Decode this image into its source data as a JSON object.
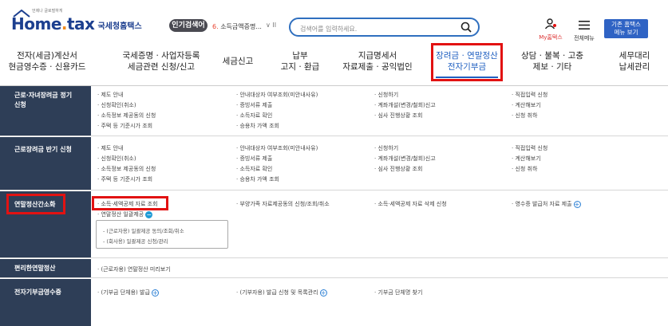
{
  "header": {
    "logo_home": "Home",
    "logo_tax": "tax",
    "logo_tag": "국세청홈택스",
    "logo_small": "언제나 글로벌하게",
    "hot_badge": "인기검색어",
    "hot_rank": "6.",
    "hot_term": "소득금액증명...",
    "hot_ctrl": "∨ II",
    "search_placeholder": "검색어를 입력하세요.",
    "my_label": "My홈택스",
    "allmenu_label": "전체메뉴",
    "basic_btn_line1": "기존 홈택스",
    "basic_btn_line2": "메뉴 보기"
  },
  "gnb": {
    "items": [
      {
        "l1": "전자(세금)계산서",
        "l2": "현금영수증 · 신용카드"
      },
      {
        "l1": "국세증명 · 사업자등록",
        "l2": "세금관련 신청/신고"
      },
      {
        "l1": "세금신고",
        "l2": ""
      },
      {
        "l1": "납부",
        "l2": "고지 · 환급"
      },
      {
        "l1": "지급명세서",
        "l2": "자료제출 · 공익법인"
      },
      {
        "l1": "장려금 · 연말정산",
        "l2": "전자기부금"
      },
      {
        "l1": "상담 · 불복 · 고충",
        "l2": "제보 · 기타"
      },
      {
        "l1": "세무대리",
        "l2": "납세관리"
      }
    ]
  },
  "rows": [
    {
      "label1": "근로·자녀장려금 정기",
      "label2": "신청",
      "col1": [
        "· 제도 안내",
        "· 신청확인(취소)",
        "· 소득정보 제공동의 신청",
        "· 주택 등 기준시가 조회"
      ],
      "col2": [
        "· 안내대상자 여부조회(미안내사유)",
        "· 증빙서류 제출",
        "· 소득자료 확인",
        "· 승용차 가액 조회"
      ],
      "col3": [
        "· 신청하기",
        "· 계좌개설(변경/철회)신고",
        "· 심사 진행상황 조회"
      ],
      "col4": [
        "· 직접입력 신청",
        "· 계산해보기",
        "· 신청 취하"
      ]
    },
    {
      "label1": "근로장려금 반기 신청",
      "label2": "",
      "col1": [
        "· 제도 안내",
        "· 신청확인(취소)",
        "· 소득정보 제공동의 신청",
        "· 주택 등 기준시가 조회"
      ],
      "col2": [
        "· 안내대상자 여부조회(미안내사유)",
        "· 증빙서류 제출",
        "· 소득자료 확인",
        "· 승용차 가액 조회"
      ],
      "col3": [
        "· 신청하기",
        "· 계좌개설(변경/철회)신고",
        "· 심사 진행상황 조회"
      ],
      "col4": [
        "· 직접입력 신청",
        "· 계산해보기",
        "· 신청 취하"
      ]
    },
    {
      "label1": "연말정산간소화",
      "col1a": "· 소득·세액공제 자료 조회",
      "col1b": "· 연말정산 일괄제공",
      "col2": "· 부양가족 자료제공동의 신청/조회/취소",
      "col3": "· 소득·세액공제 자료 삭제 신청",
      "col4": "· 영수증 발급처 자료 제출",
      "sub1": "- (근로자용) 일괄제공 동의/조회/취소",
      "sub2": "- (회사용) 일괄제공 신청/관리"
    },
    {
      "label1": "편리한연말정산",
      "col1": "· (근로자용) 연말정산 미리보기"
    },
    {
      "label1": "전자기부금영수증",
      "col1": "· (기부금 단체용) 발급",
      "col2": "· (기부자용) 발급 신청 및 목록관리",
      "col3": "· 기부금 단체명 찾기"
    }
  ],
  "colors": {
    "navy": "#2e3e57",
    "highlight_red": "#e21212",
    "accent_blue": "#1f5fc0"
  }
}
